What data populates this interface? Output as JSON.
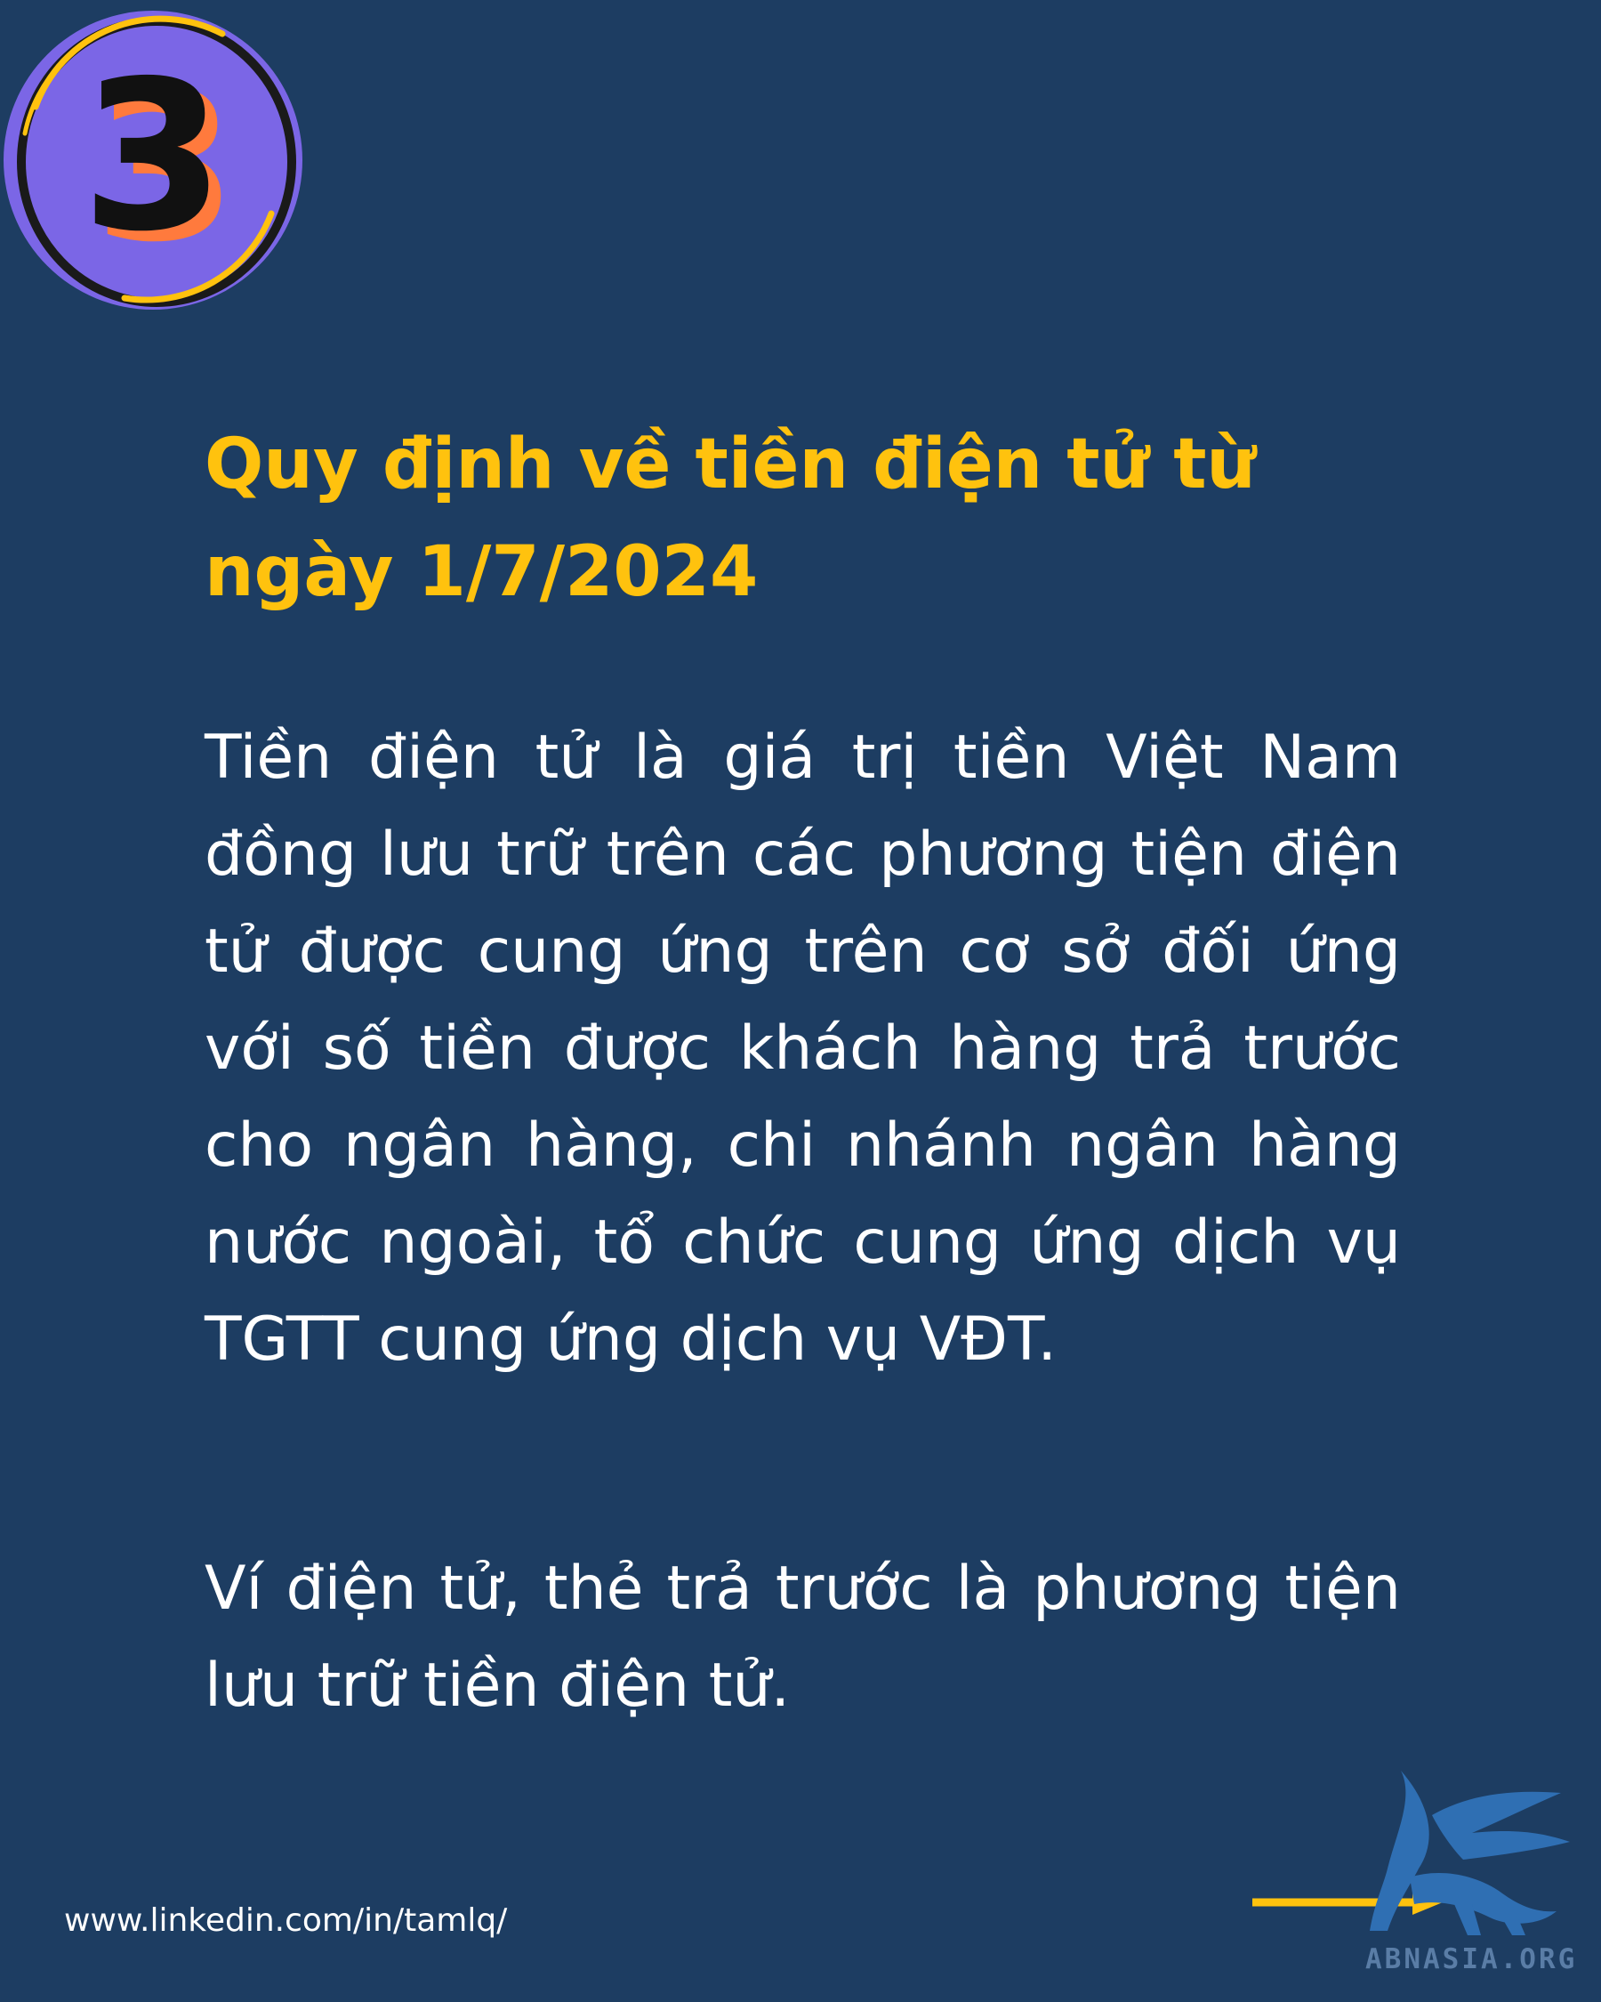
{
  "badge": {
    "number": "3",
    "fill_color": "#7b66e6",
    "ring_color": "#1a1a1a",
    "accent_color": "#ffc20e",
    "shadow_color": "#ff7a3d"
  },
  "title": "Quy định về tiền điện tử từ ngày 1/7/2024",
  "paragraphs": [
    "Tiền điện tử là giá trị tiền Việt Nam đồng lưu trữ trên các phương tiện điện tử được cung ứng trên cơ sở đối ứng với số tiền được khách hàng trả trước cho ngân hàng, chi nhánh ngân hàng nước ngoài, tổ chức cung ứng dịch vụ TGTT cung ứng dịch vụ VĐT.",
    "Ví điện tử, thẻ trả trước là phương tiện lưu trữ tiền điện tử."
  ],
  "footer": {
    "link_text": "www.linkedin.com/in/tamlq/"
  },
  "watermark": {
    "text": "ABNASIA.ORG",
    "logo_icon": "griffin-logo-icon"
  },
  "next_arrow_icon": "arrow-right-icon",
  "colors": {
    "background": "#1d3d62",
    "title": "#ffc20e",
    "body_text": "#ffffff",
    "arrow": "#ffc20e",
    "logo": "#2f6fb3"
  }
}
